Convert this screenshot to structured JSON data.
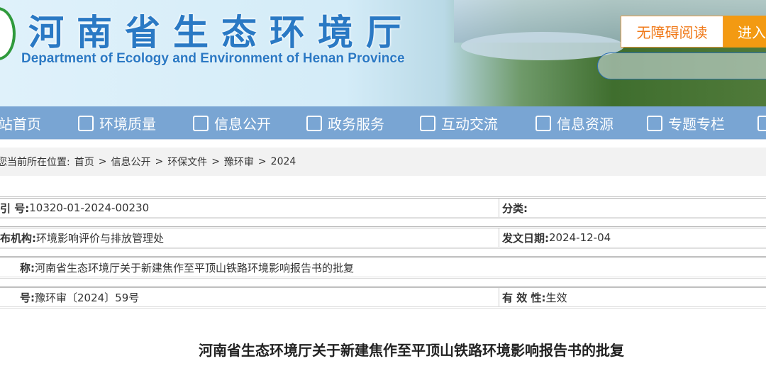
{
  "header": {
    "title_cn": "河南省生态环境厅",
    "title_en": "Department of Ecology and Environment of Henan Province",
    "accessible_label": "无障碍阅读",
    "enter_label": "进入"
  },
  "nav": [
    {
      "label": "站首页",
      "icon": "home-icon"
    },
    {
      "label": "环境质量",
      "icon": "network-icon"
    },
    {
      "label": "信息公开",
      "icon": "document-icon"
    },
    {
      "label": "政务服务",
      "icon": "layers-icon"
    },
    {
      "label": "互动交流",
      "icon": "chat-icon"
    },
    {
      "label": "信息资源",
      "icon": "file-icon"
    },
    {
      "label": "专题专栏",
      "icon": "edit-icon"
    }
  ],
  "breadcrumb": {
    "prefix": "您当前所在位置:",
    "items": [
      "首页",
      "信息公开",
      "环保文件",
      "豫环审",
      "2024"
    ],
    "sep": ">"
  },
  "meta": {
    "index_label": "引 号:",
    "index_value": "10320-01-2024-00230",
    "category_label": "分类:",
    "publisher_label": "布机构:",
    "publisher_value": "环境影响评价与排放管理处",
    "date_label": "发文日期:",
    "date_value": "2024-12-04",
    "name_label": "称:",
    "name_value": "河南省生态环境厅关于新建焦作至平顶山铁路环境影响报告书的批复",
    "docno_label": "号:",
    "docno_value": "豫环审〔2024〕59号",
    "validity_label": "有 效 性:",
    "validity_value": "生效"
  },
  "document_title": "河南省生态环境厅关于新建焦作至平顶山铁路环境影响报告书的批复"
}
